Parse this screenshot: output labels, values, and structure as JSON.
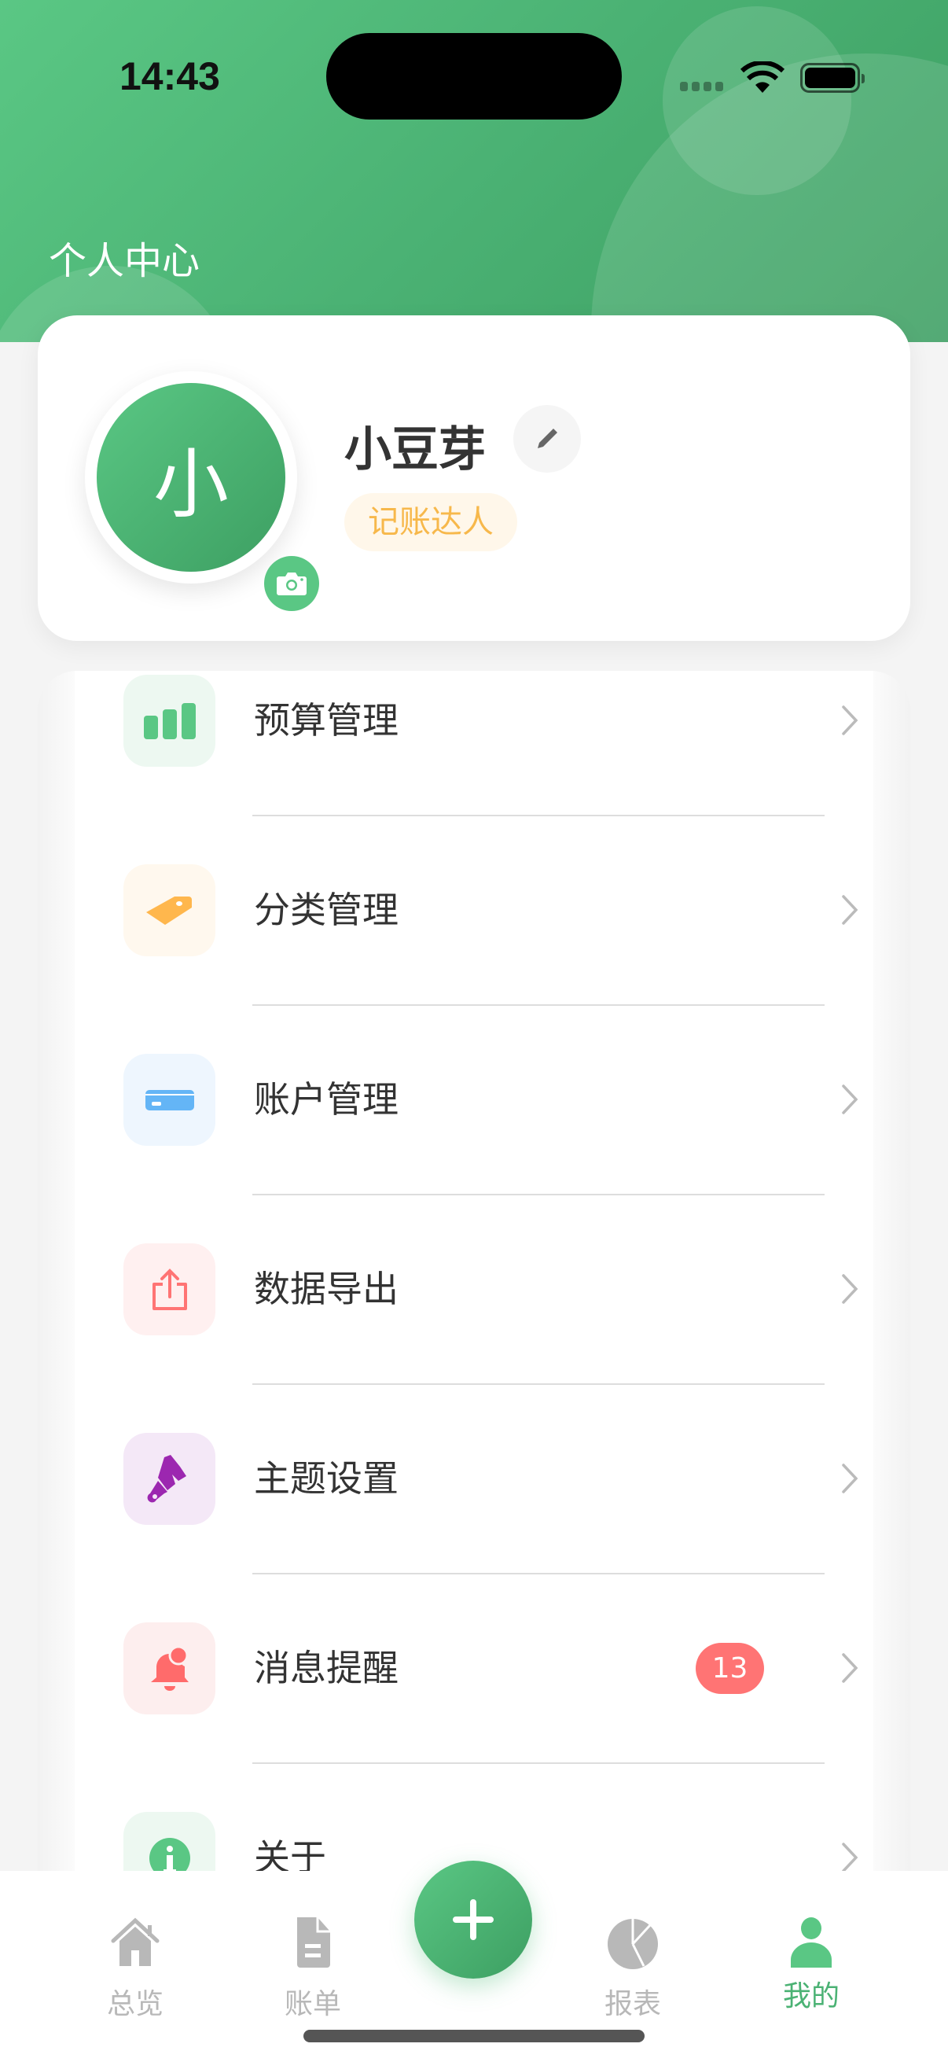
{
  "status_bar": {
    "time": "14:43"
  },
  "header": {
    "title": "个人中心"
  },
  "profile": {
    "avatar_text": "小",
    "name": "小豆芽",
    "level_badge": "记账达人"
  },
  "menu": [
    {
      "label": "预算管理",
      "icon": "bar-chart-icon",
      "color": "#5ac784",
      "bg": "#edf8f1"
    },
    {
      "label": "分类管理",
      "icon": "tag-icon",
      "color": "#ffb74d",
      "bg": "#fff8ee"
    },
    {
      "label": "账户管理",
      "icon": "credit-card-icon",
      "color": "#64b5f6",
      "bg": "#eef6fe"
    },
    {
      "label": "数据导出",
      "icon": "share-export-icon",
      "color": "#ff7474",
      "bg": "#fff0f0"
    },
    {
      "label": "主题设置",
      "icon": "paint-brush-icon",
      "color": "#9c27b0",
      "bg": "#f4e8f7"
    },
    {
      "label": "消息提醒",
      "icon": "bell-icon",
      "color": "#ff6b6b",
      "bg": "#fdeeee",
      "badge": "13"
    },
    {
      "label": "关于",
      "icon": "info-icon",
      "color": "#5ac784",
      "bg": "#edf8f1"
    }
  ],
  "tabbar": {
    "tabs": [
      {
        "label": "总览",
        "icon": "home-icon"
      },
      {
        "label": "账单",
        "icon": "document-icon"
      },
      {
        "label": "报表",
        "icon": "pie-chart-icon"
      },
      {
        "label": "我的",
        "icon": "person-icon",
        "active": true
      }
    ],
    "add_button": "add-icon"
  },
  "colors": {
    "brand": "#4bb274",
    "inactive": "#b8b8b8"
  }
}
